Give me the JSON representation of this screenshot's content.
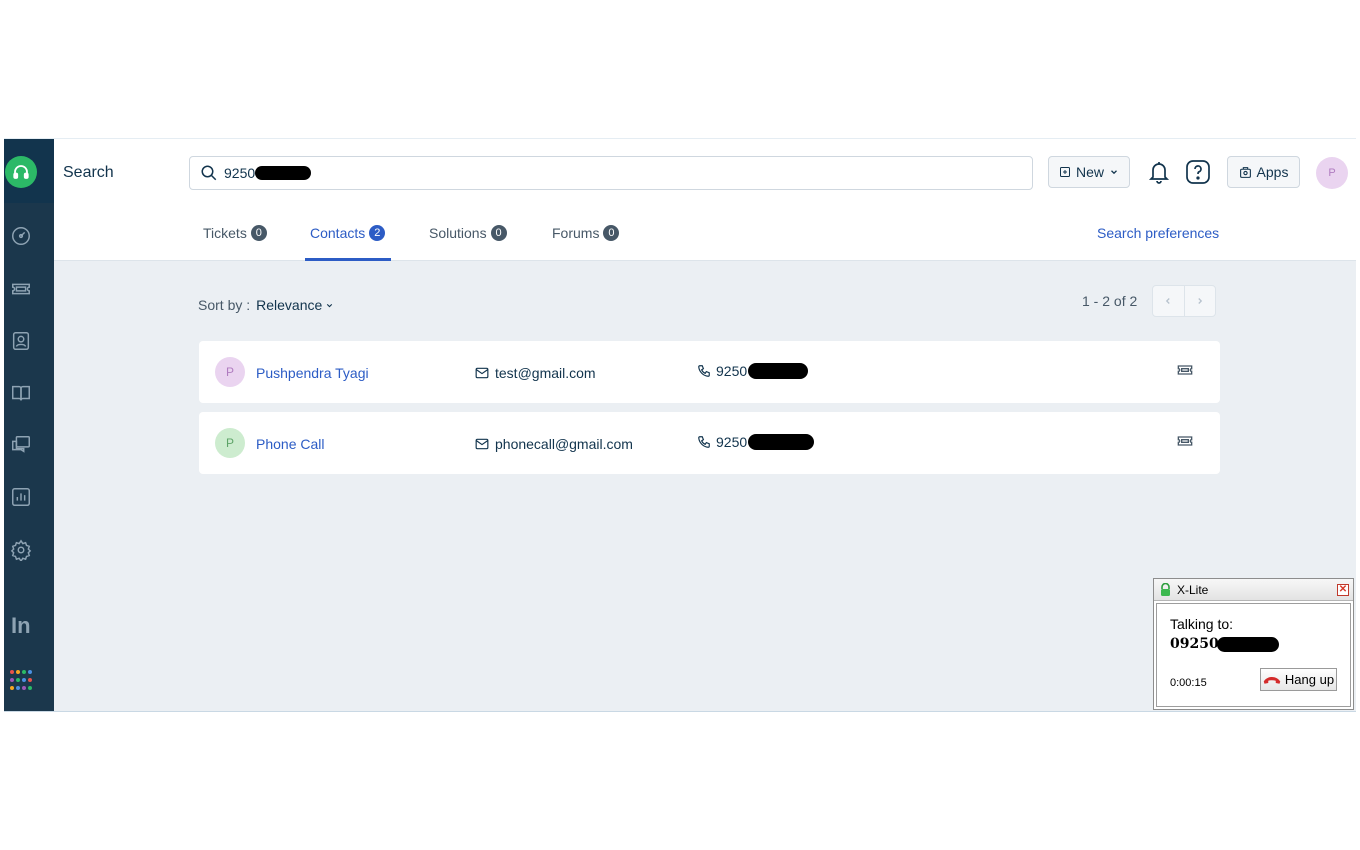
{
  "header": {
    "page_title": "Search",
    "search_value": "9250",
    "new_label": "New",
    "apps_label": "Apps",
    "avatar_initial": "P"
  },
  "tabs": [
    {
      "label": "Tickets",
      "count": "0"
    },
    {
      "label": "Contacts",
      "count": "2"
    },
    {
      "label": "Solutions",
      "count": "0"
    },
    {
      "label": "Forums",
      "count": "0"
    }
  ],
  "search_preferences_label": "Search preferences",
  "sort": {
    "label": "Sort by :",
    "value": "Relevance"
  },
  "pagination": {
    "text": "1 - 2 of 2"
  },
  "contacts": [
    {
      "initial": "P",
      "name": "Pushpendra Tyagi",
      "email": "test@gmail.com",
      "phone": "9250"
    },
    {
      "initial": "P",
      "name": "Phone Call",
      "email": "phonecall@gmail.com",
      "phone": "9250"
    }
  ],
  "sidebar_text": {
    "in_logo": "In"
  },
  "xlite": {
    "title": "X-Lite",
    "talking_label": "Talking to:",
    "number": "09250",
    "timer": "0:00:15",
    "hangup_label": "Hang up"
  },
  "colors": {
    "accent": "#2c5cc5",
    "sidebar": "#1b374c",
    "logo_green": "#2cb967",
    "background": "#ebeff3"
  }
}
